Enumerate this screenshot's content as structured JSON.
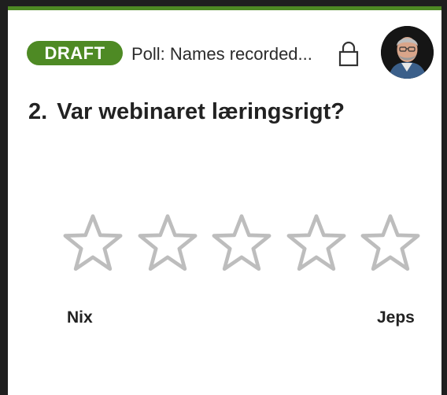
{
  "poll": {
    "status_badge": "DRAFT",
    "title": "Poll: Names recorded...",
    "question_number": "2.",
    "question_text": "Var webinaret læringsrigt?",
    "rating": {
      "max": 5,
      "selected": 0,
      "min_label": "Nix",
      "max_label": "Jeps"
    }
  },
  "icons": {
    "lock": "lock-icon",
    "star": "star-outline-icon"
  },
  "colors": {
    "accent": "#4e8a24",
    "star_outline": "#bdbdbd",
    "text": "#222222"
  }
}
